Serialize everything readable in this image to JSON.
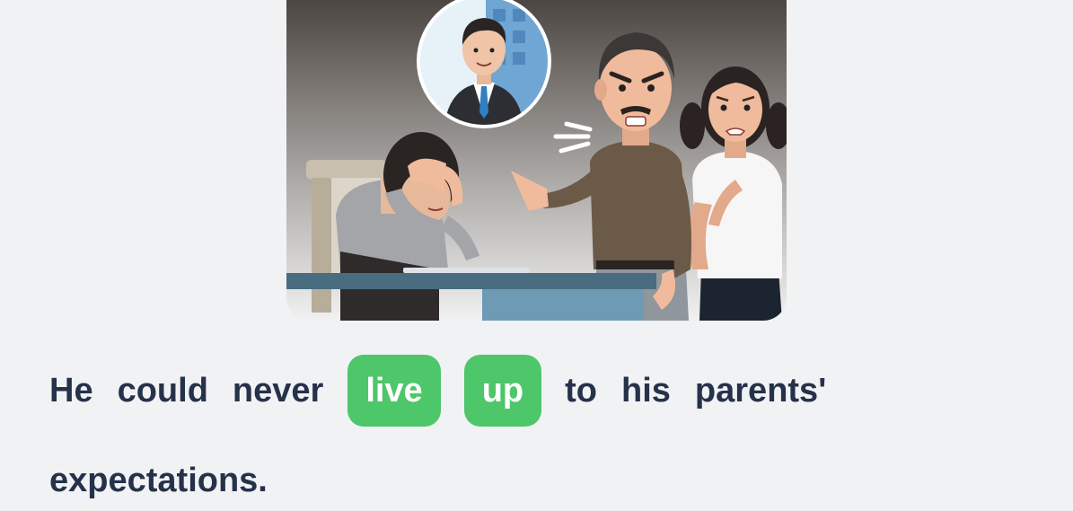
{
  "sentence": {
    "before": [
      "He",
      "could",
      "never"
    ],
    "highlights": [
      "live",
      "up"
    ],
    "after": [
      "to",
      "his",
      "parents'"
    ],
    "line2": "expectations."
  },
  "colors": {
    "background": "#f1f2f4",
    "text": "#26324a",
    "highlight": "#4ec66a",
    "highlight_text": "#ffffff"
  },
  "illustration": {
    "subject": "dejected young man at desk scolded by angry father and worried mother, thought bubble of successful businessman",
    "icons": [
      "thought-bubble",
      "businessman",
      "angry-father",
      "worried-mother",
      "sad-son",
      "desk",
      "chair"
    ]
  }
}
